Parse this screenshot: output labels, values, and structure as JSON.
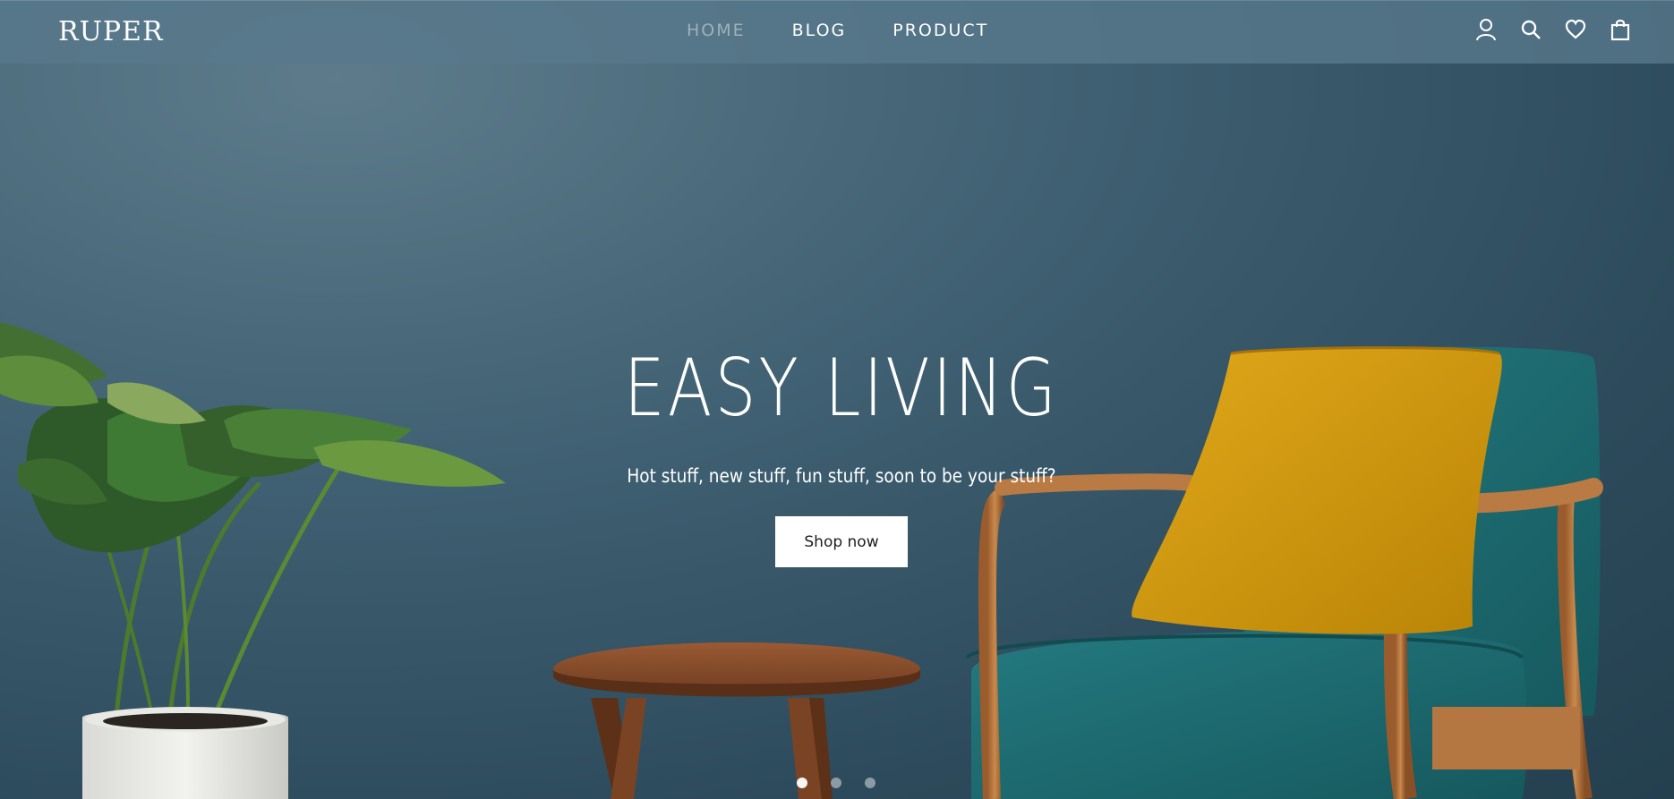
{
  "brand": {
    "logo_text": "RUPER"
  },
  "nav": {
    "items": [
      {
        "label": "HOME",
        "active": true
      },
      {
        "label": "BLOG",
        "active": false
      },
      {
        "label": "PRODUCT",
        "active": false
      }
    ]
  },
  "header_icons": [
    "user-icon",
    "search-icon",
    "heart-icon",
    "shopping-bag-icon"
  ],
  "hero": {
    "title": "EASY LIVING",
    "subtitle": "Hot stuff, new stuff, fun stuff, soon to be your stuff?",
    "cta_label": "Shop now"
  },
  "carousel": {
    "slide_count": 3,
    "active_index": 0
  },
  "colors": {
    "background": "#3a5a6b",
    "header_bar": "#58798c",
    "nav_active": "#9fb0ba",
    "text": "#ffffff",
    "cta_background": "#ffffff",
    "cushion_accent": "#d39d0e",
    "chair_fabric": "#1f6b70"
  }
}
